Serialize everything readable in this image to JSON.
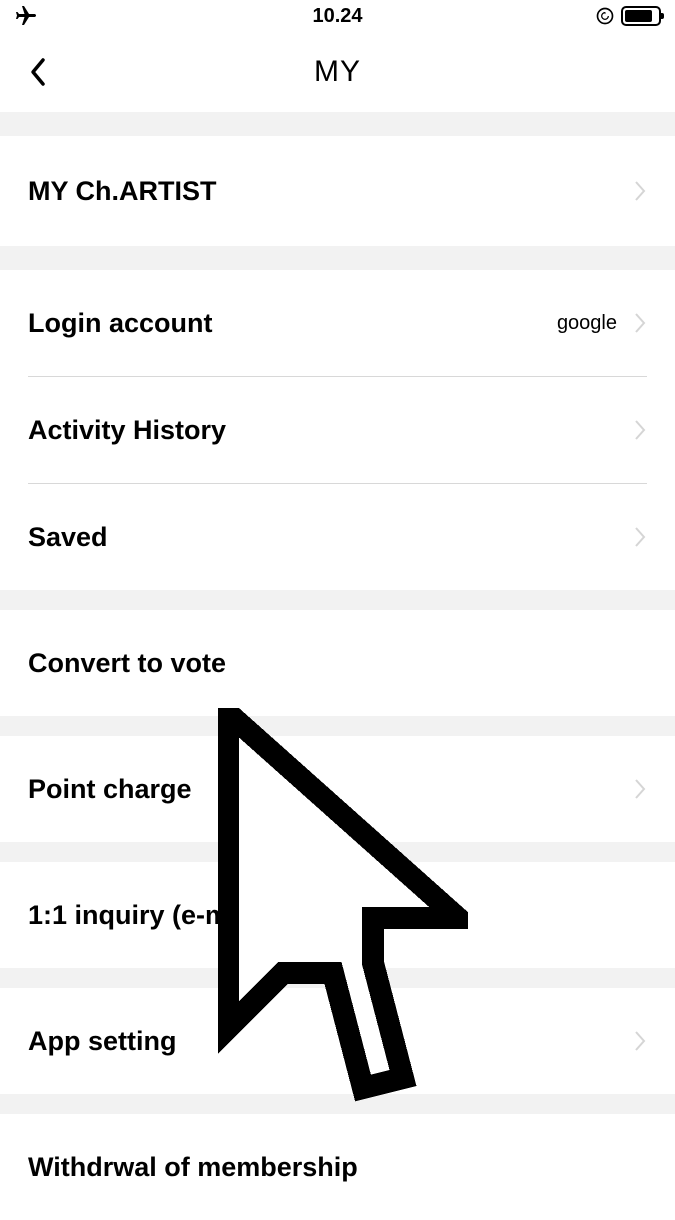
{
  "status": {
    "time": "10.24"
  },
  "header": {
    "title": "MY"
  },
  "sections": {
    "artist": {
      "label": "MY Ch.ARTIST"
    },
    "login": {
      "label": "Login account",
      "value": "google"
    },
    "activity": {
      "label": "Activity History"
    },
    "saved": {
      "label": "Saved"
    },
    "convert": {
      "label": "Convert to vote"
    },
    "point": {
      "label": "Point charge"
    },
    "inquiry": {
      "label": "1:1 inquiry (e-mail)"
    },
    "appsetting": {
      "label": "App setting"
    },
    "withdrawal": {
      "label": "Withdrwal of membership"
    }
  }
}
